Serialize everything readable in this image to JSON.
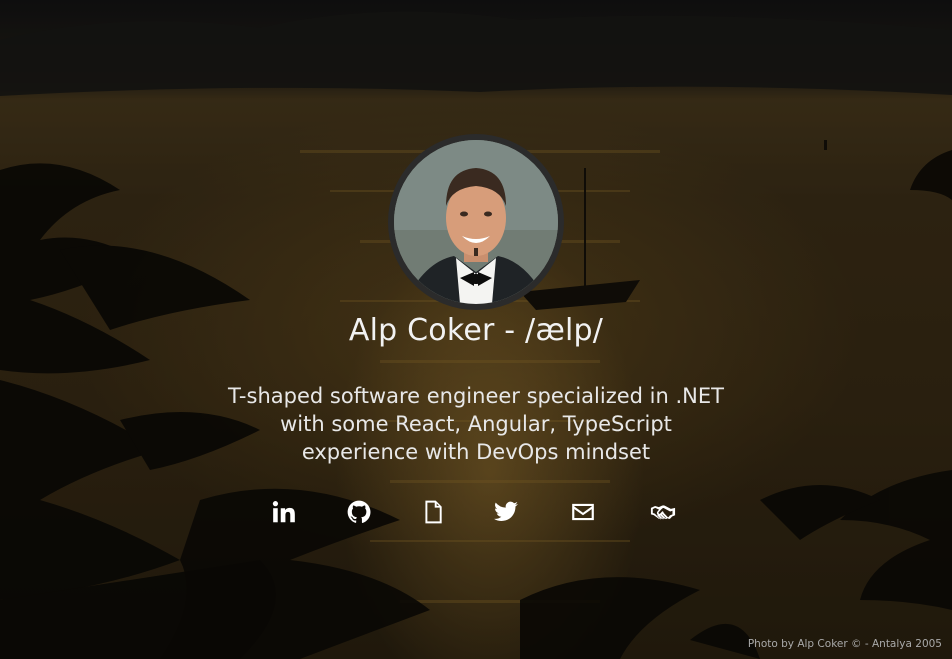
{
  "profile": {
    "name": "Alp Coker - /ælp/",
    "tagline_lines": [
      "T-shaped software engineer specialized in .NET",
      "with some React, Angular, TypeScript",
      "experience with DevOps mindset"
    ],
    "avatar_alt": "profile photo"
  },
  "socials": [
    {
      "id": "linkedin",
      "icon": "linkedin-icon"
    },
    {
      "id": "github",
      "icon": "github-icon"
    },
    {
      "id": "resume",
      "icon": "document-icon"
    },
    {
      "id": "twitter",
      "icon": "twitter-icon"
    },
    {
      "id": "email",
      "icon": "envelope-icon"
    },
    {
      "id": "hire",
      "icon": "handshake-icon"
    }
  ],
  "footer": {
    "photo_credit": "Photo by Alp Coker © - Antalya 2005"
  },
  "colors": {
    "text": "#f2f2f2",
    "icon": "#ffffff",
    "avatar_border": "#2b2b2b",
    "credit": "#a9a9a9"
  }
}
